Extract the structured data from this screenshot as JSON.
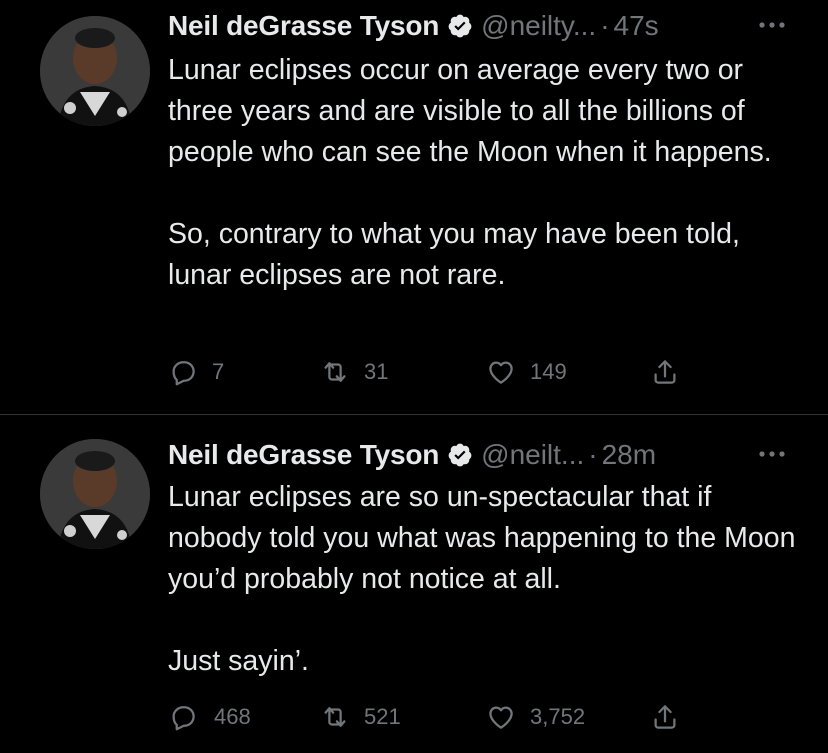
{
  "colors": {
    "background": "#000000",
    "primary_text": "#e7e9ea",
    "secondary_text": "#71767b",
    "divider": "#2f3336",
    "verified_badge": "#e7e9ea"
  },
  "tweets": [
    {
      "author_name": "Neil deGrasse Tyson",
      "handle": "@neilty...",
      "separator": "·",
      "time": "47s",
      "paragraphs": [
        "Lunar eclipses occur on average every two or three years and are visible to all the billions of people who can see the Moon when it happens.",
        "So, contrary to what you may have been told, lunar eclipses are not rare."
      ],
      "replies": "7",
      "retweets": "31",
      "likes": "149",
      "icons": {
        "reply": "reply-icon",
        "retweet": "retweet-icon",
        "like": "heart-icon",
        "share": "share-icon",
        "more": "more-icon",
        "verified": "verified-badge-icon"
      }
    },
    {
      "author_name": "Neil deGrasse Tyson",
      "handle": "@neilt...",
      "separator": "·",
      "time": "28m",
      "paragraphs": [
        "Lunar eclipses are so un-spectacular that if nobody told you what was happening to the Moon you’d probably not notice at all.",
        "Just sayin’."
      ],
      "replies": "468",
      "retweets": "521",
      "likes": "3,752",
      "icons": {
        "reply": "reply-icon",
        "retweet": "retweet-icon",
        "like": "heart-icon",
        "share": "share-icon",
        "more": "more-icon",
        "verified": "verified-badge-icon"
      }
    }
  ]
}
